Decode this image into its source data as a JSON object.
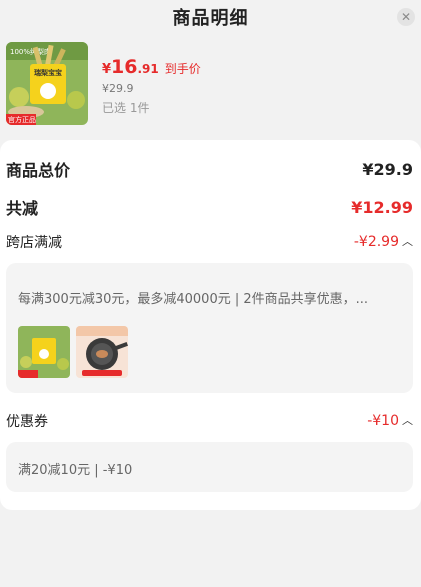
{
  "header": {
    "title": "商品明细"
  },
  "product": {
    "price_symbol": "¥",
    "price_int": "16",
    "price_dec": ".91",
    "price_tag": "到手价",
    "original_price": "¥29.9",
    "selected": "已选 1件",
    "image_badge_top": "100%纯梨肉",
    "image_brand": "瑞梨宝宝",
    "image_badge_bottom": "官方正品"
  },
  "summary": {
    "total_label": "商品总价",
    "total_value": "¥29.9",
    "discount_label": "共减",
    "discount_value": "¥12.99"
  },
  "store_promo": {
    "label": "跨店满减",
    "value": "-¥2.99",
    "description": "每满300元减30元，最多减40000元 | 2件商品共享优惠，...",
    "items": [
      "pear-product",
      "pan-product"
    ]
  },
  "coupon": {
    "label": "优惠券",
    "value": "-¥10",
    "description": "满20减10元 | -¥10"
  },
  "colors": {
    "accent": "#e62b2b",
    "background": "#f2f2f2"
  }
}
